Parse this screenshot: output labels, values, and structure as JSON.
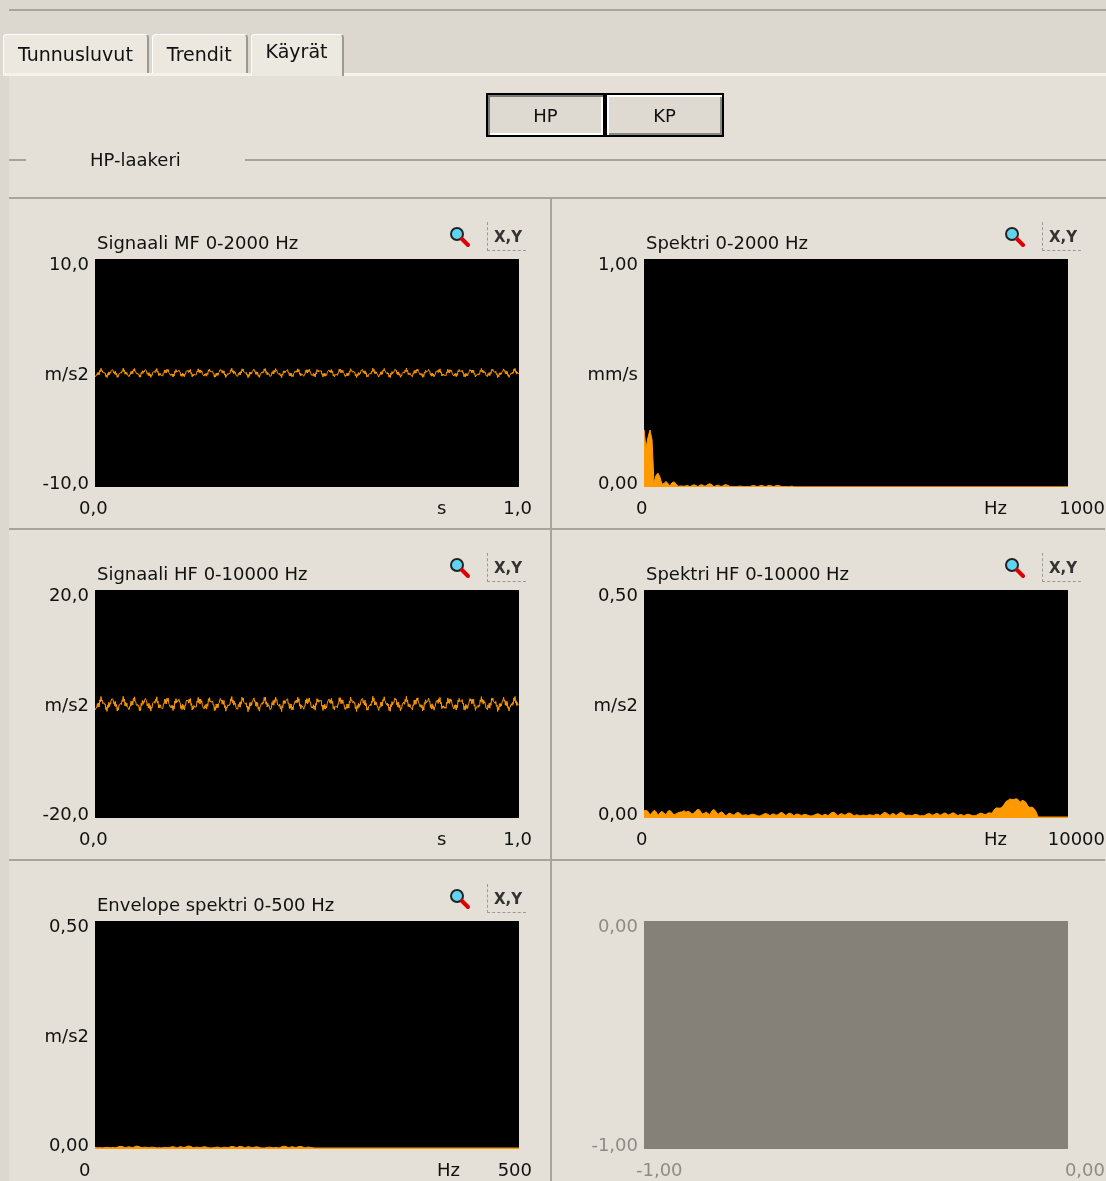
{
  "tabs": [
    {
      "label": "Tunnusluvut",
      "selected": false
    },
    {
      "label": "Trendit",
      "selected": false
    },
    {
      "label": "Käyrät",
      "selected": true
    }
  ],
  "bearing_buttons": [
    {
      "label": "HP",
      "selected": true
    },
    {
      "label": "KP",
      "selected": false
    }
  ],
  "group": {
    "title": "HP-laakeri"
  },
  "panels": [
    {
      "title": "Signaali MF 0-2000 Hz",
      "xy_label": "X,Y",
      "disabled": false,
      "kind": "noise-band",
      "ymax": "10,0",
      "yunit": "m/s2",
      "ymin": "-10,0",
      "xmin": "0,0",
      "xunit": "s",
      "xmax": "1,0"
    },
    {
      "title": "Spektri 0-2000 Hz",
      "xy_label": "X,Y",
      "disabled": false,
      "kind": "low-peak",
      "ymax": "1,00",
      "yunit": "mm/s",
      "ymin": "0,00",
      "xmin": "0",
      "xunit": "Hz",
      "xmax": "1000"
    },
    {
      "title": "Signaali HF 0-10000 Hz",
      "xy_label": "X,Y",
      "disabled": false,
      "kind": "wide-noise-band",
      "ymax": "20,0",
      "yunit": "m/s2",
      "ymin": "-20,0",
      "xmin": "0,0",
      "xunit": "s",
      "xmax": "1,0"
    },
    {
      "title": "Spektri HF 0-10000 Hz",
      "xy_label": "X,Y",
      "disabled": false,
      "kind": "high-bump",
      "ymax": "0,50",
      "yunit": "m/s2",
      "ymin": "0,00",
      "xmin": "0",
      "xunit": "Hz",
      "xmax": "10000"
    },
    {
      "title": "Envelope spektri 0-500 Hz",
      "xy_label": "X,Y",
      "disabled": false,
      "kind": "flat-line",
      "ymax": "0,50",
      "yunit": "m/s2",
      "ymin": "0,00",
      "xmin": "0",
      "xunit": "Hz",
      "xmax": "500"
    },
    {
      "disabled": true,
      "kind": "empty",
      "ymax": "0,00",
      "ymin": "-1,00",
      "xmin": "-1,00",
      "xmax": "0,00"
    }
  ]
}
